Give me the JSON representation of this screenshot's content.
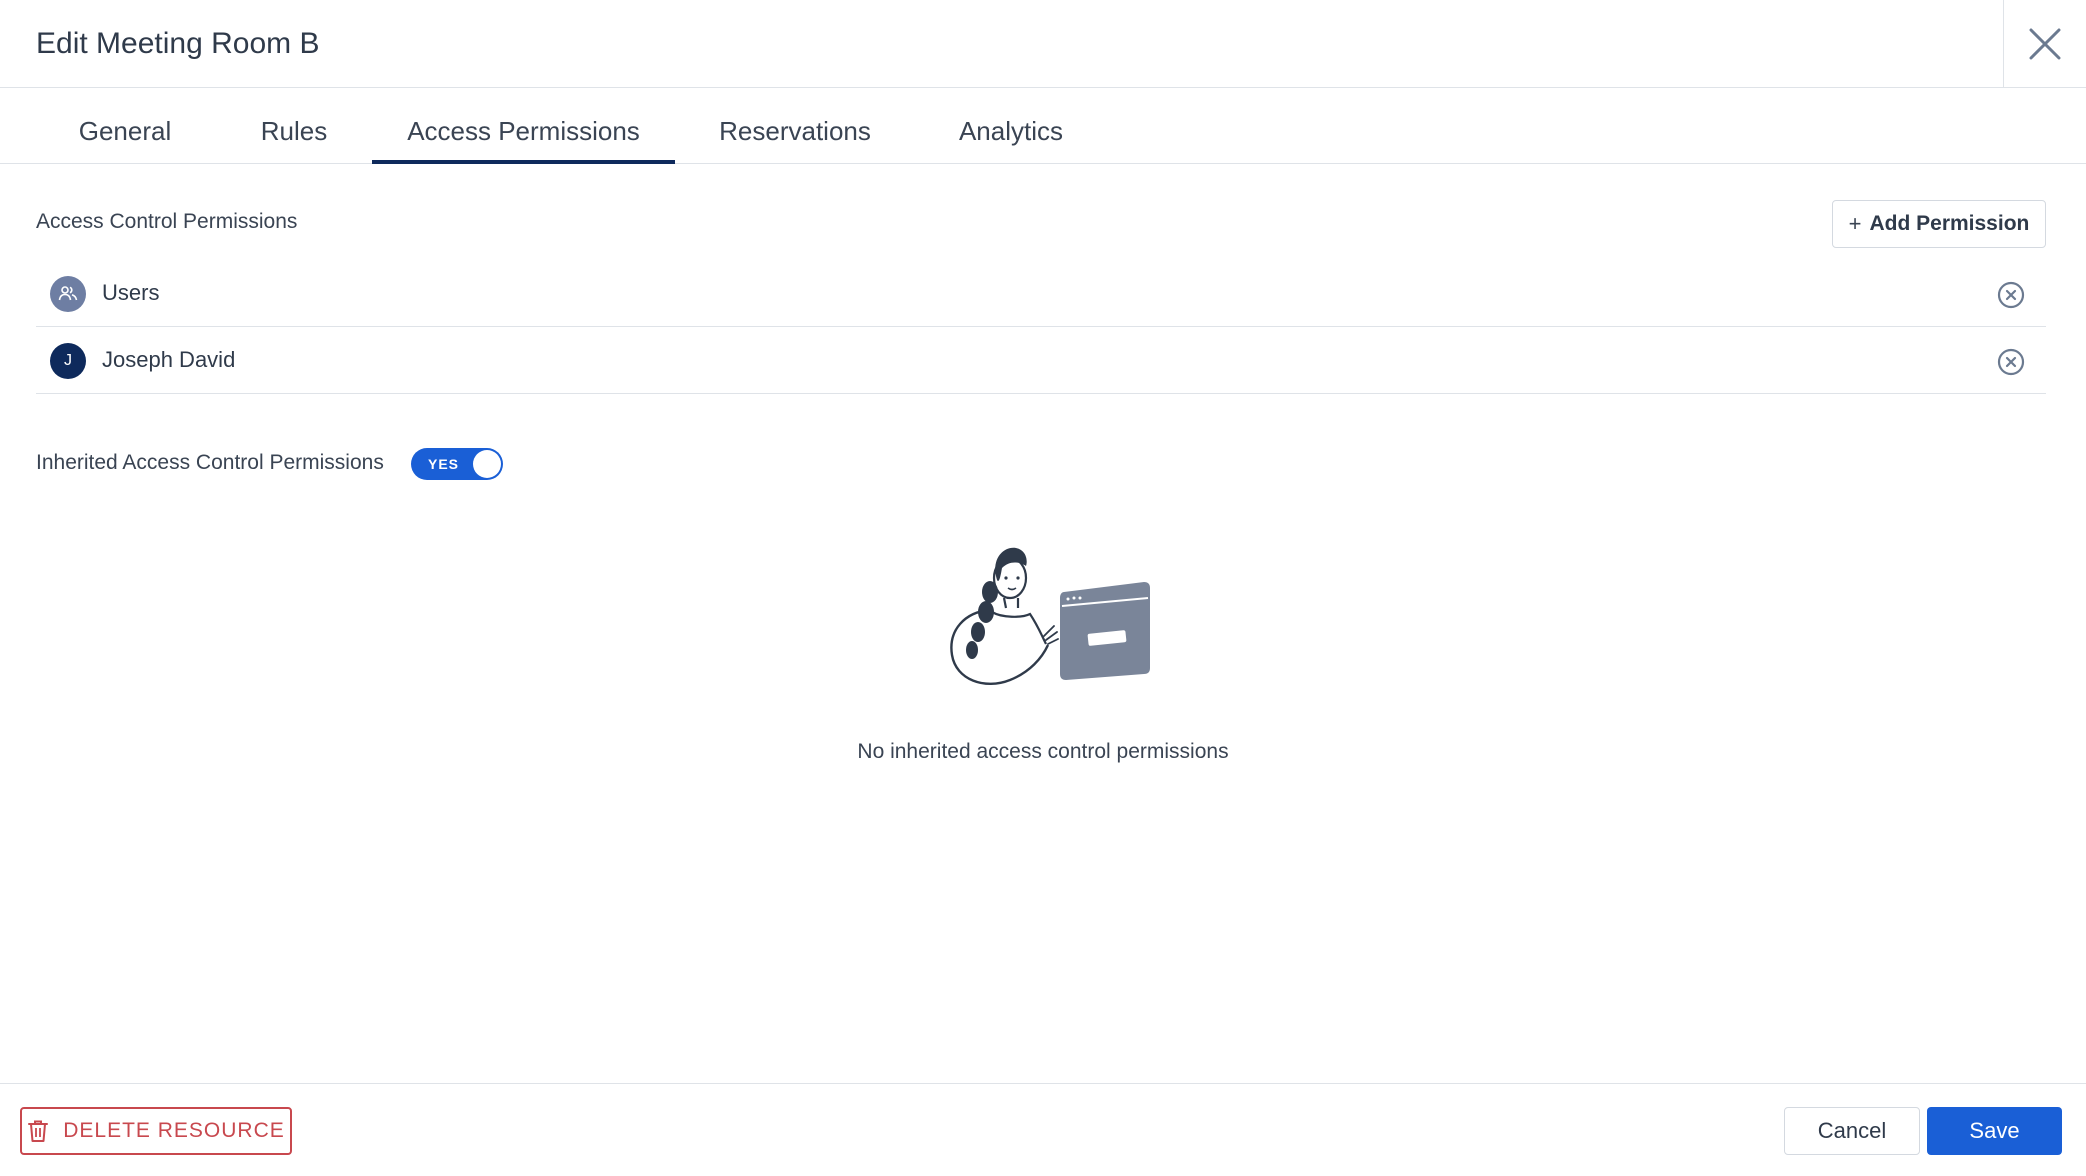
{
  "dialog": {
    "title": "Edit Meeting Room B",
    "close_icon": "close-icon"
  },
  "tabs": [
    {
      "label": "General",
      "active": false
    },
    {
      "label": "Rules",
      "active": false
    },
    {
      "label": "Access Permissions",
      "active": true
    },
    {
      "label": "Reservations",
      "active": false
    },
    {
      "label": "Analytics",
      "active": false
    }
  ],
  "access_control": {
    "section_label": "Access Control Permissions",
    "add_button_label": "Add Permission",
    "add_button_icon": "plus-icon",
    "items": [
      {
        "name": "Users",
        "avatar_type": "group-icon",
        "avatar_text": ""
      },
      {
        "name": "Joseph David",
        "avatar_type": "initial",
        "avatar_text": "J"
      }
    ],
    "remove_icon": "remove-circle-icon"
  },
  "inherited": {
    "label": "Inherited Access Control Permissions",
    "toggle_text": "YES",
    "toggle_on": true,
    "empty_message": "No inherited access control permissions",
    "illustration": "person-with-browser-illustration"
  },
  "footer": {
    "delete_label": "DELETE RESOURCE",
    "delete_icon": "trash-icon",
    "cancel_label": "Cancel",
    "save_label": "Save"
  },
  "colors": {
    "primary": "#1a5fd6",
    "active_tab": "#0e2a5c",
    "danger": "#c8484e",
    "text": "#2f3a4a"
  }
}
